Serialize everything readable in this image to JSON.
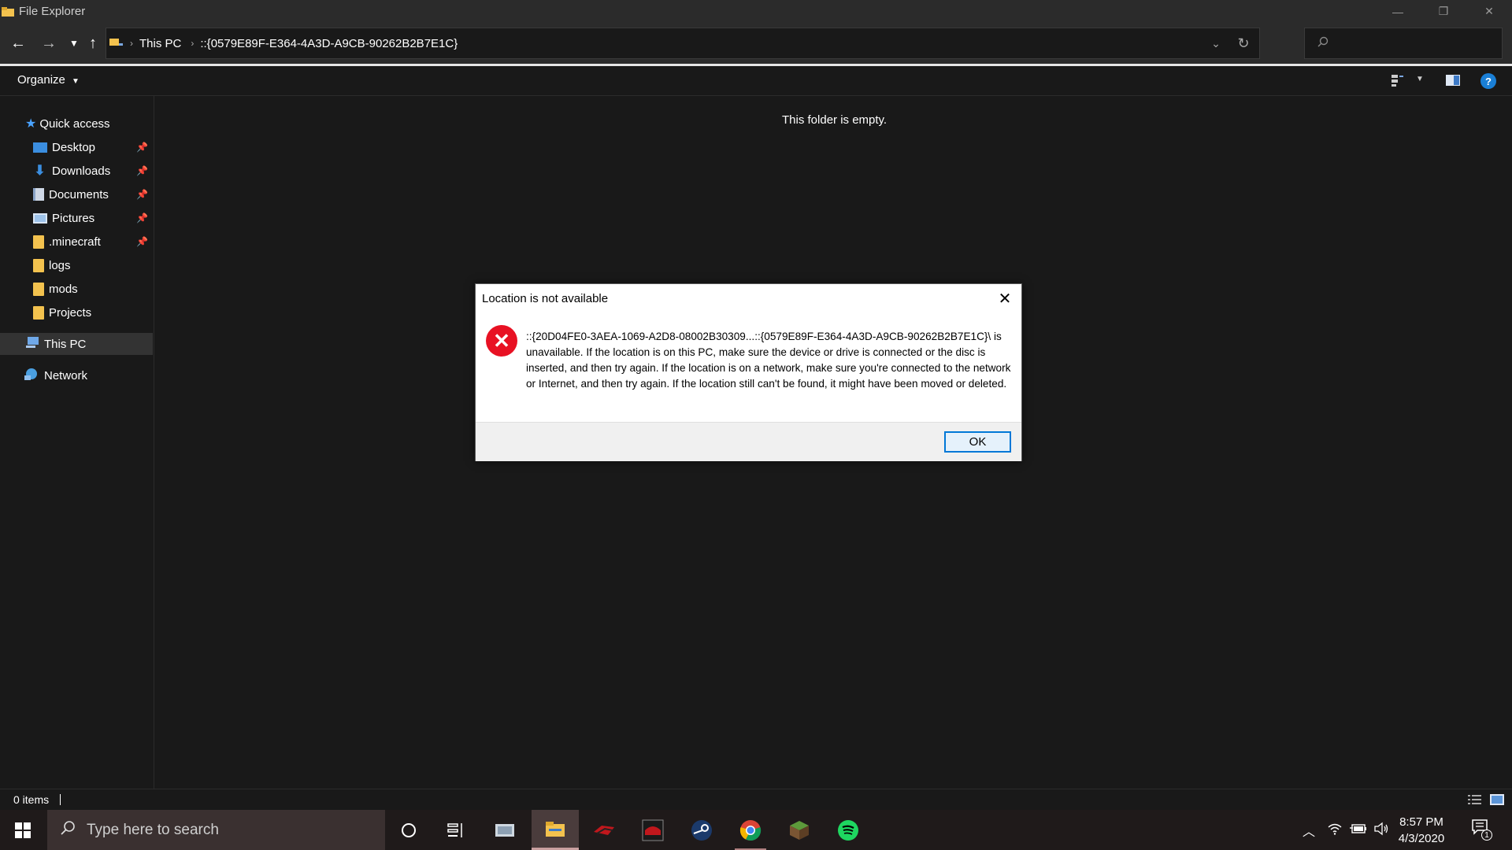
{
  "window": {
    "title": "File Explorer",
    "minimize": "—",
    "maximize": "❐",
    "close": "✕"
  },
  "address": {
    "crumbs": [
      "This PC",
      "::{0579E89F-E364-4A3D-A9CB-90262B2B7E1C}"
    ]
  },
  "command_bar": {
    "organize_label": "Organize",
    "help_label": "?"
  },
  "nav": {
    "quick_access": "Quick access",
    "items": [
      {
        "label": "Desktop",
        "pinned": true
      },
      {
        "label": "Downloads",
        "pinned": true
      },
      {
        "label": "Documents",
        "pinned": true
      },
      {
        "label": "Pictures",
        "pinned": true
      },
      {
        "label": ".minecraft",
        "pinned": true
      },
      {
        "label": "logs",
        "pinned": false
      },
      {
        "label": "mods",
        "pinned": false
      },
      {
        "label": "Projects",
        "pinned": false
      }
    ],
    "this_pc": "This PC",
    "network": "Network"
  },
  "main": {
    "empty_message": "This folder is empty."
  },
  "status": {
    "item_count": "0 items"
  },
  "dialog": {
    "title": "Location is not available",
    "message": "::{20D04FE0-3AEA-1069-A2D8-08002B30309...::{0579E89F-E364-4A3D-A9CB-90262B2B7E1C}\\ is unavailable. If the location is on this PC, make sure the device or drive is connected or the disc is inserted, and then try again. If the location is on a network, make sure you're connected to the network or Internet, and then try again. If the location still can't be found, it might have been moved or deleted.",
    "ok_label": "OK"
  },
  "taskbar": {
    "search_placeholder": "Type here to search",
    "time": "8:57 PM",
    "date": "4/3/2020",
    "notification_count": "1"
  },
  "colors": {
    "accent": "#0078d7",
    "error": "#e81123",
    "folder": "#f3c24e"
  }
}
